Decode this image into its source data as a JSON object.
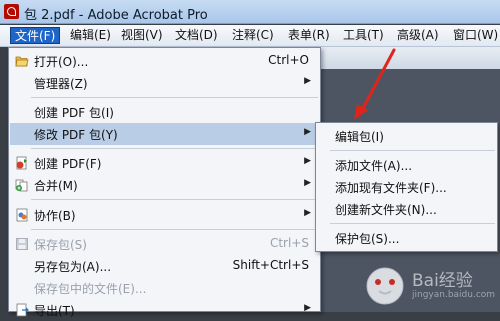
{
  "window": {
    "title": "包 2.pdf - Adobe Acrobat Pro"
  },
  "menubar": {
    "items": [
      {
        "label": "文件(F)",
        "active": true
      },
      {
        "label": "编辑(E)"
      },
      {
        "label": "视图(V)"
      },
      {
        "label": "文档(D)"
      },
      {
        "label": "注释(C)"
      },
      {
        "label": "表单(R)"
      },
      {
        "label": "工具(T)"
      },
      {
        "label": "高级(A)"
      },
      {
        "label": "窗口(W)"
      }
    ]
  },
  "file_menu": {
    "items": [
      {
        "label": "打开(O)...",
        "shortcut": "Ctrl+O",
        "icon": "folder-open-icon"
      },
      {
        "label": "管理器(Z)",
        "submenu": true
      },
      {
        "label": "创建 PDF 包(I)"
      },
      {
        "label": "修改 PDF 包(Y)",
        "submenu": true,
        "highlighted": true
      },
      {
        "label": "创建 PDF(F)",
        "submenu": true,
        "icon": "create-pdf-icon"
      },
      {
        "label": "合并(M)",
        "submenu": true,
        "icon": "combine-icon"
      },
      {
        "label": "协作(B)",
        "submenu": true,
        "icon": "collaborate-icon"
      },
      {
        "label": "保存包(S)",
        "shortcut": "Ctrl+S",
        "disabled": true,
        "icon": "save-icon"
      },
      {
        "label": "另存包为(A)...",
        "shortcut": "Shift+Ctrl+S"
      },
      {
        "label": "保存包中的文件(E)...",
        "disabled": true
      },
      {
        "label": "导出(T)",
        "submenu": true,
        "icon": "export-icon"
      }
    ]
  },
  "submenu": {
    "items": [
      {
        "label": "编辑包(I)"
      },
      {
        "label": "添加文件(A)..."
      },
      {
        "label": "添加现有文件夹(F)..."
      },
      {
        "label": "创建新文件夹(N)..."
      },
      {
        "label": "保护包(S)..."
      }
    ]
  },
  "watermark": {
    "text": "Bai经验",
    "url": "jingyan.baidu.com"
  },
  "colors": {
    "highlight": "#b9cde6",
    "menu_active": "#1f65c8",
    "annotation_arrow": "#e0241b"
  }
}
